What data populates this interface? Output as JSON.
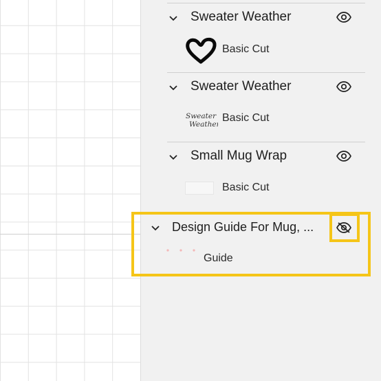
{
  "layers": [
    {
      "title": "Sweater Weather",
      "operation": "Basic Cut",
      "thumbnail_icon": "heart-doodle",
      "visible": true
    },
    {
      "title": "Sweater Weather",
      "operation": "Basic Cut",
      "thumbnail_icon": "sweater-weather-script",
      "visible": true
    },
    {
      "title": "Small Mug Wrap",
      "operation": "Basic Cut",
      "thumbnail_icon": "blank-rectangle",
      "visible": true
    },
    {
      "title": "Design Guide For Mug, ...",
      "operation": "Guide",
      "thumbnail_icon": "guide-dots",
      "visible": false
    }
  ],
  "thumbnail_script_text": "Sweater Weather",
  "colors": {
    "highlight": "#f5c518",
    "panel_bg": "#f1f1f1",
    "text": "#1e1e1e"
  }
}
